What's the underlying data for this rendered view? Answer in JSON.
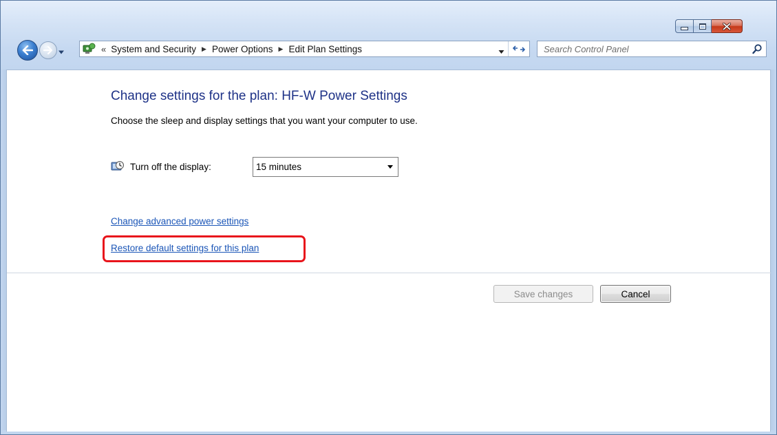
{
  "window": {
    "minimize_icon": "minimize-icon",
    "maximize_icon": "maximize-icon",
    "close_icon": "close-icon"
  },
  "navigation": {
    "back_icon": "back-arrow-icon",
    "forward_icon": "forward-arrow-icon",
    "address_icon": "control-panel-icon",
    "breadcrumb": {
      "overflow": "«",
      "items": [
        "System and Security",
        "Power Options",
        "Edit Plan Settings"
      ]
    },
    "refresh_icon": "refresh-icon"
  },
  "search": {
    "placeholder": "Search Control Panel",
    "icon": "search-icon"
  },
  "main": {
    "title": "Change settings for the plan: HF-W Power Settings",
    "subtitle": "Choose the sleep and display settings that you want your computer to use.",
    "display_setting": {
      "icon": "display-timer-icon",
      "label": "Turn off the display:",
      "value": "15 minutes"
    },
    "links": {
      "advanced": "Change advanced power settings",
      "restore": "Restore default settings for this plan"
    },
    "buttons": {
      "save": "Save changes",
      "cancel": "Cancel"
    }
  },
  "colors": {
    "title": "#1e3287",
    "link": "#1a55b7",
    "highlight": "#e8141b"
  }
}
